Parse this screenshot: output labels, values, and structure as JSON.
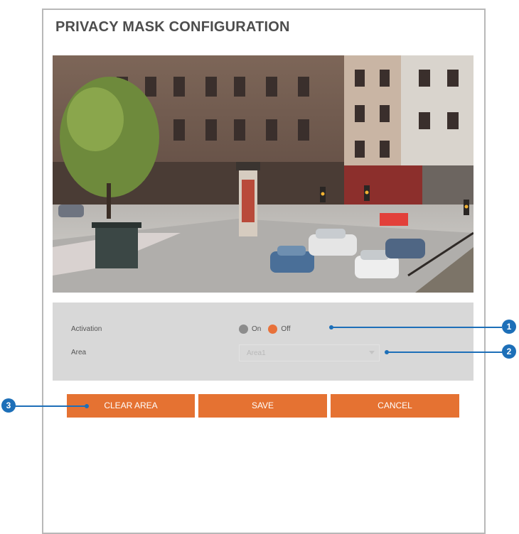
{
  "title": "PRIVACY MASK CONFIGURATION",
  "settings": {
    "activation_label": "Activation",
    "activation_on_label": "On",
    "activation_off_label": "Off",
    "activation_selected": "Off",
    "area_label": "Area",
    "area_value": "Area1"
  },
  "buttons": {
    "clear_area": "CLEAR AREA",
    "save": "SAVE",
    "cancel": "CANCEL"
  },
  "callouts": [
    "1",
    "2",
    "3"
  ],
  "colors": {
    "accent": "#e57232",
    "callout": "#1d6fb8",
    "panel_bg": "#d8d8d8"
  }
}
